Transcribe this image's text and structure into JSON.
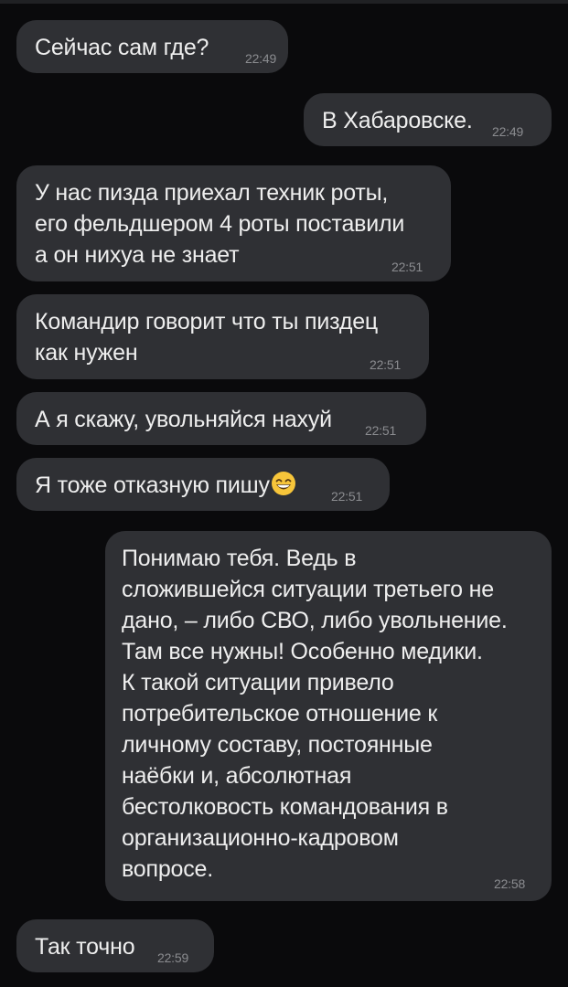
{
  "messages": [
    {
      "id": "m1",
      "direction": "incoming",
      "text": "Сейчас сам где?",
      "time": "22:49"
    },
    {
      "id": "m2",
      "direction": "outgoing",
      "text": "В Хабаровске.",
      "time": "22:49"
    },
    {
      "id": "m3",
      "direction": "incoming",
      "text": "У нас пизда приехал техник роты,\nего фельдшером 4 роты поставили\nа он нихуа не знает",
      "time": "22:51"
    },
    {
      "id": "m4",
      "direction": "incoming",
      "text": "Командир говорит что ты пиздец\nкак нужен",
      "time": "22:51"
    },
    {
      "id": "m5",
      "direction": "incoming",
      "text": "А я скажу, увольняйся нахуй",
      "time": "22:51"
    },
    {
      "id": "m6",
      "direction": "incoming",
      "text": "Я тоже отказную пишу",
      "emoji": "grinning-face-with-smiling-eyes",
      "time": "22:51"
    },
    {
      "id": "m7",
      "direction": "outgoing",
      "text": "Понимаю тебя. Ведь в\nсложившейся ситуации третьего не\nдано, – либо СВО, либо увольнение.\nТам все нужны! Особенно медики.\nК такой ситуации привело\nпотребительское отношение к\nличному составу, постоянные\nнаёбки и, абсолютная\nбестолковость командования в\nорганизационно-кадровом\nвопросе.",
      "time": "22:58"
    },
    {
      "id": "m8",
      "direction": "incoming",
      "text": "Так точно",
      "time": "22:59"
    }
  ],
  "colors": {
    "background": "#0a0a0c",
    "bubble": "#2f3034",
    "text": "#eeeeee",
    "time": "#8b8c90"
  }
}
